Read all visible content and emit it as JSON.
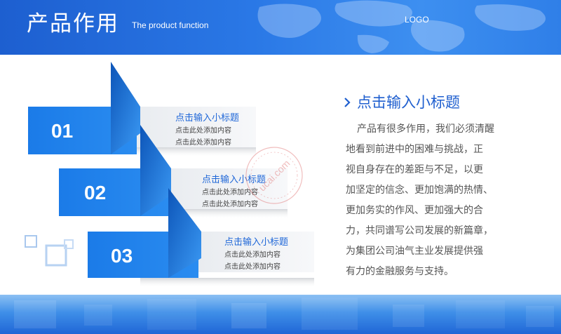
{
  "header": {
    "title": "产品作用",
    "subtitle": "The product function",
    "logo": "LOGO"
  },
  "steps": [
    {
      "number": "01",
      "title": "点击输入小标题",
      "lines": [
        "点击此处添加内容",
        "点击此处添加内容"
      ]
    },
    {
      "number": "02",
      "title": "点击输入小标题",
      "lines": [
        "点击此处添加内容",
        "点击此处添加内容"
      ]
    },
    {
      "number": "03",
      "title": "点击输入小标题",
      "lines": [
        "点击此处添加内容",
        "点击此处添加内容"
      ]
    }
  ],
  "watermark": "ucai.com",
  "panel": {
    "heading": "点击输入小标题",
    "paragraph_lines": [
      "产品有很多作用，我们必须清醒",
      "地看到前进中的困难与挑战，正",
      "视自身存在的差距与不足，以更",
      "加坚定的信念、更加饱满的热情、",
      "更加务实的作风、更加强大的合",
      "力，共同谱写公司发展的新篇章，",
      "为集团公司油气主业发展提供强",
      "有力的金融服务与支持。"
    ]
  },
  "colors": {
    "accent_blue": "#1f7ae0",
    "dark_blue": "#1f5fcf",
    "header_blue": "#2a78e6"
  }
}
